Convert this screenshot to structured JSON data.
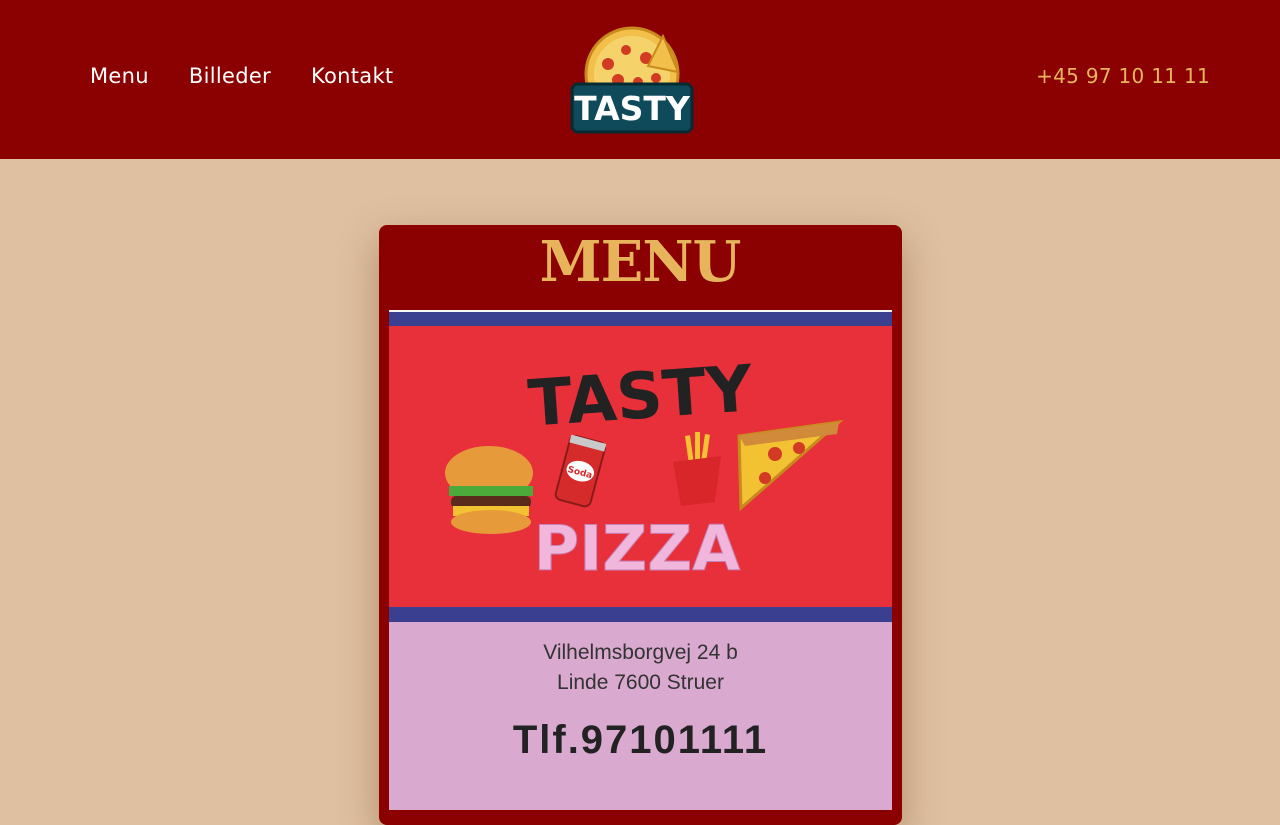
{
  "nav": {
    "items": [
      {
        "label": "Menu"
      },
      {
        "label": "Billeder"
      },
      {
        "label": "Kontakt"
      }
    ],
    "phone": "+45 97 10 11 11"
  },
  "logo": {
    "text": "TASTY"
  },
  "menu_card": {
    "title": "MENU",
    "image": {
      "brand_top": "TASTY",
      "brand_bottom": "PIZZA",
      "can_label": "Soda",
      "address_line1": "Vilhelmsborgvej 24 b",
      "address_line2": "Linde 7600 Struer",
      "phone": "Tlf.97101111"
    }
  },
  "colors": {
    "header_bg": "#8b0000",
    "page_bg": "#dfc0a0",
    "accent_gold": "#e7b45c",
    "menu_red": "#e8303a",
    "menu_blue": "#3a3f8f",
    "menu_pink": "#d9a9d0"
  }
}
